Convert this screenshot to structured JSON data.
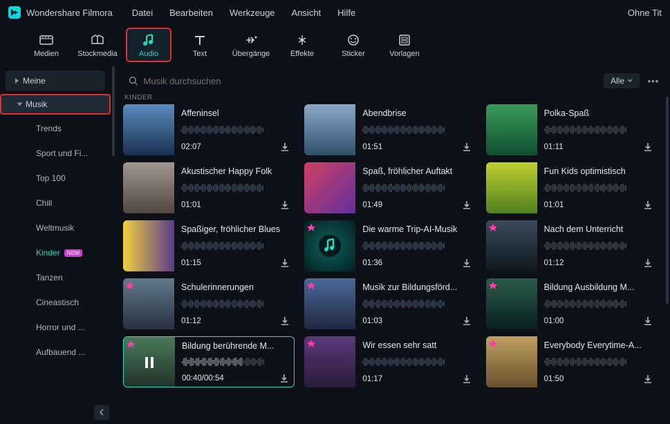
{
  "app": {
    "name": "Wondershare Filmora",
    "status": "Ohne Tit"
  },
  "menu": [
    "Datei",
    "Bearbeiten",
    "Werkzeuge",
    "Ansicht",
    "Hilfe"
  ],
  "tools": {
    "items": [
      {
        "id": "media",
        "label": "Medien"
      },
      {
        "id": "stock",
        "label": "Stockmedia"
      },
      {
        "id": "audio",
        "label": "Audio"
      },
      {
        "id": "text",
        "label": "Text"
      },
      {
        "id": "trans",
        "label": "Übergänge"
      },
      {
        "id": "fx",
        "label": "Effekte"
      },
      {
        "id": "sticker",
        "label": "Sticker"
      },
      {
        "id": "tpl",
        "label": "Vorlagen"
      }
    ],
    "active": "audio"
  },
  "sidebar": {
    "roots": [
      {
        "label": "Meine",
        "sel": false
      },
      {
        "label": "Musik",
        "sel": true
      }
    ],
    "subs": [
      {
        "label": "Trends"
      },
      {
        "label": "Sport und Fi..."
      },
      {
        "label": "Top 100"
      },
      {
        "label": "Chill"
      },
      {
        "label": "Weltmusik"
      },
      {
        "label": "Kinder",
        "active": true,
        "new": true
      },
      {
        "label": "Tanzen"
      },
      {
        "label": "Cineastisch"
      },
      {
        "label": "Horror und ..."
      },
      {
        "label": "Aufbauend ..."
      }
    ]
  },
  "search": {
    "placeholder": "Musik durchsuchen",
    "filter": "Alle"
  },
  "section": "KINDER",
  "tracks": [
    {
      "title": "Affeninsel",
      "time": "02:07",
      "fav": false,
      "g": "a"
    },
    {
      "title": "Abendbrise",
      "time": "01:51",
      "fav": false,
      "g": "b"
    },
    {
      "title": "Polka-Spaß",
      "time": "01:11",
      "fav": false,
      "g": "c"
    },
    {
      "title": "Akustischer Happy Folk",
      "time": "01:01",
      "fav": false,
      "g": "d"
    },
    {
      "title": "Spaß, fröhlicher Auftakt",
      "time": "01:49",
      "fav": false,
      "g": "e"
    },
    {
      "title": "Fun Kids optimistisch",
      "time": "01:01",
      "fav": false,
      "g": "f"
    },
    {
      "title": "Spaßiger, fröhlicher Blues",
      "time": "01:15",
      "fav": false,
      "g": "g"
    },
    {
      "title": "Die warme Trip-AI-Musik",
      "time": "01:36",
      "fav": true,
      "g": "h"
    },
    {
      "title": "Nach dem Unterricht",
      "time": "01:12",
      "fav": true,
      "g": "i"
    },
    {
      "title": "Schulerinnerungen",
      "time": "01:12",
      "fav": true,
      "g": "j"
    },
    {
      "title": "Musik zur Bildungsförd...",
      "time": "01:03",
      "fav": true,
      "g": "k"
    },
    {
      "title": "Bildung Ausbildung M...",
      "time": "01:00",
      "fav": true,
      "g": "l"
    },
    {
      "title": "Bildung berührende M...",
      "time": "00:40/00:54",
      "fav": true,
      "playing": true,
      "g": "m"
    },
    {
      "title": "Wir essen sehr satt",
      "time": "01:17",
      "fav": true,
      "g": "n"
    },
    {
      "title": "Everybody Everytime-A...",
      "time": "01:50",
      "fav": true,
      "g": "o"
    }
  ]
}
